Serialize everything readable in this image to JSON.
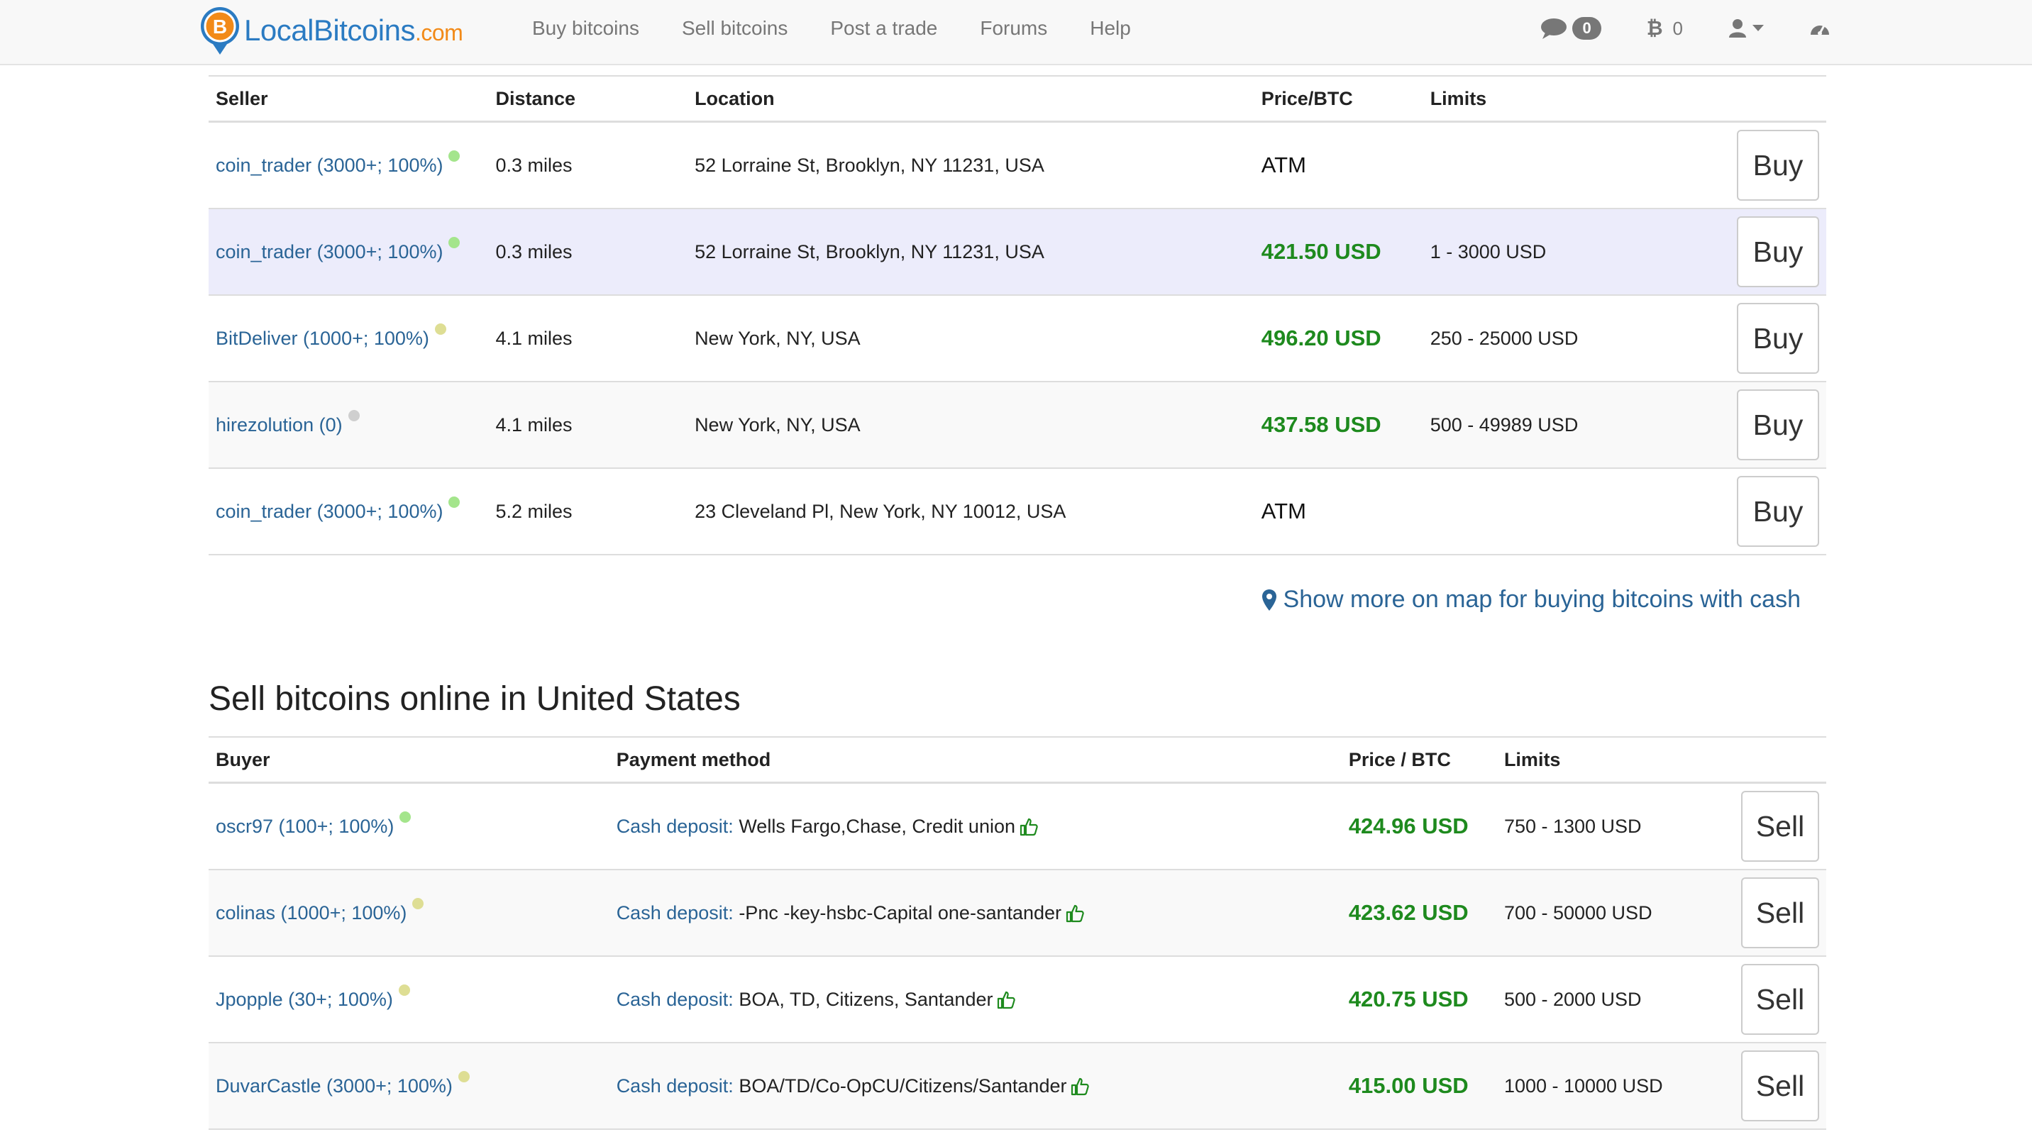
{
  "nav": {
    "logo_text": "LocalBitcoins",
    "logo_suffix": ".com",
    "links": [
      "Buy bitcoins",
      "Sell bitcoins",
      "Post a trade",
      "Forums",
      "Help"
    ],
    "messages_count": "0",
    "btc_balance": "0"
  },
  "buy_table": {
    "headers": [
      "Seller",
      "Distance",
      "Location",
      "Price/BTC",
      "Limits"
    ],
    "button_label": "Buy",
    "rows": [
      {
        "seller": "coin_trader (3000+; 100%)",
        "status_color": "#a4e58c",
        "distance": "0.3 miles",
        "location": "52 Lorraine St, Brooklyn, NY 11231, USA",
        "price": "ATM",
        "is_atm": true,
        "limits": ""
      },
      {
        "seller": "coin_trader (3000+; 100%)",
        "status_color": "#a4e58c",
        "distance": "0.3 miles",
        "location": "52 Lorraine St, Brooklyn, NY 11231, USA",
        "price": "421.50 USD",
        "is_atm": false,
        "limits": "1 - 3000 USD"
      },
      {
        "seller": "BitDeliver (1000+; 100%)",
        "status_color": "#dede94",
        "distance": "4.1 miles",
        "location": "New York, NY, USA",
        "price": "496.20 USD",
        "is_atm": false,
        "limits": "250 - 25000 USD"
      },
      {
        "seller": "hirezolution (0)",
        "status_color": "#cfcfcf",
        "distance": "4.1 miles",
        "location": "New York, NY, USA",
        "price": "437.58 USD",
        "is_atm": false,
        "limits": "500 - 49989 USD"
      },
      {
        "seller": "coin_trader (3000+; 100%)",
        "status_color": "#a4e58c",
        "distance": "5.2 miles",
        "location": "23 Cleveland Pl, New York, NY 10012, USA",
        "price": "ATM",
        "is_atm": true,
        "limits": ""
      }
    ]
  },
  "map_link": "Show more on map for buying bitcoins with cash",
  "sell_section": {
    "title": "Sell bitcoins online in United States",
    "headers": [
      "Buyer",
      "Payment method",
      "Price / BTC",
      "Limits"
    ],
    "button_label": "Sell",
    "rows": [
      {
        "buyer": "oscr97 (100+; 100%)",
        "status_color": "#a4e58c",
        "method": "Cash deposit:",
        "detail": "Wells Fargo,Chase, Credit union",
        "price": "424.96 USD",
        "limits": "750 - 1300 USD"
      },
      {
        "buyer": "colinas (1000+; 100%)",
        "status_color": "#dede94",
        "method": "Cash deposit:",
        "detail": "-Pnc -key-hsbc-Capital one-santander",
        "price": "423.62 USD",
        "limits": "700 - 50000 USD"
      },
      {
        "buyer": "Jpopple (30+; 100%)",
        "status_color": "#dede94",
        "method": "Cash deposit:",
        "detail": "BOA, TD, Citizens, Santander",
        "price": "420.75 USD",
        "limits": "500 - 2000 USD"
      },
      {
        "buyer": "DuvarCastle (3000+; 100%)",
        "status_color": "#dede94",
        "method": "Cash deposit:",
        "detail": "BOA/TD/Co-OpCU/Citizens/Santander",
        "price": "415.00 USD",
        "limits": "1000 - 10000 USD"
      }
    ]
  },
  "colors": {
    "accent": "#2a6496",
    "price_green": "#1e8a1e",
    "logo_blue": "#2b7bc2",
    "logo_orange": "#f28a18",
    "hover_row": "#ececfb"
  }
}
